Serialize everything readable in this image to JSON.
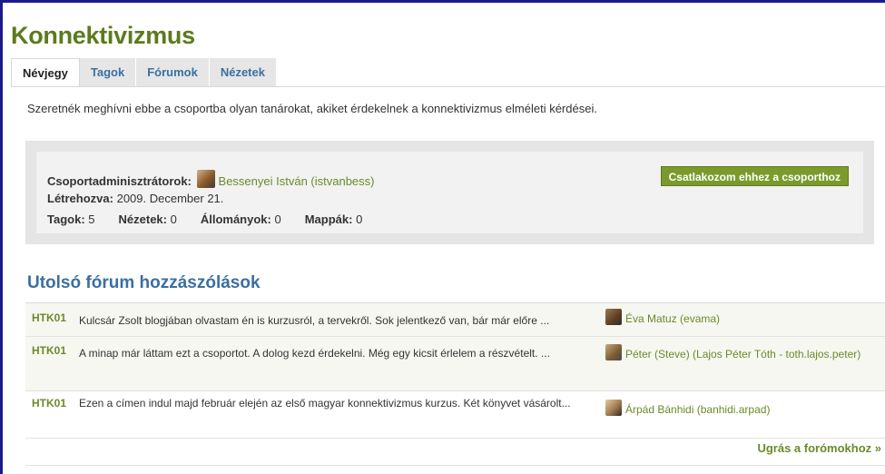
{
  "group": {
    "title": "Konnektivizmus",
    "description": "Szeretnék meghívni ebbe a csoportba olyan tanárokat, akiket érdekelnek a konnektivizmus elméleti kérdései."
  },
  "tabs": [
    {
      "label": "Névjegy",
      "active": true
    },
    {
      "label": "Tagok",
      "active": false
    },
    {
      "label": "Fórumok",
      "active": false
    },
    {
      "label": "Nézetek",
      "active": false
    }
  ],
  "info": {
    "admins_label": "Csoportadminisztrátorok:",
    "admin_name": "Bessenyei István (istvanbess)",
    "created_label": "Létrehozva:",
    "created_value": "2009. December 21.",
    "stats": [
      {
        "label": "Tagok:",
        "value": "5"
      },
      {
        "label": "Nézetek:",
        "value": "0"
      },
      {
        "label": "Állományok:",
        "value": "0"
      },
      {
        "label": "Mappák:",
        "value": "0"
      }
    ],
    "join_button": "Csatlakozom ehhez a csoporthoz"
  },
  "forum": {
    "heading": "Utolsó fórum hozzászólások",
    "posts": [
      {
        "tag": "HTK01",
        "text": "Kulcsár Zsolt blogjában olvastam én is kurzusról, a tervekről. Sok jelentkező van, bár már előre ...",
        "author": "Éva Matuz (evama)"
      },
      {
        "tag": "HTK01",
        "text": "A minap már láttam ezt a csoportot. A dolog kezd érdekelni. Még egy kicsit érlelem a részvételt. ...",
        "author": "Péter (Steve) (Lajos Péter Tóth - toth.lajos.peter)"
      },
      {
        "tag": "HTK01",
        "text": "Ezen a címen indul majd február elején az első magyar konnektivizmus kurzus. Két könyvet vásárolt...",
        "author": "Árpád Bánhidi (banhidi.arpad)"
      }
    ],
    "jump_link": "Ugrás a forómokhoz »"
  },
  "colors": {
    "title_green": "#5b7b1b",
    "link_green": "#6b8a2a",
    "heading_blue": "#3b6fa3",
    "frame_blue": "#1a1a8c",
    "button_green": "#7b9a2c"
  }
}
